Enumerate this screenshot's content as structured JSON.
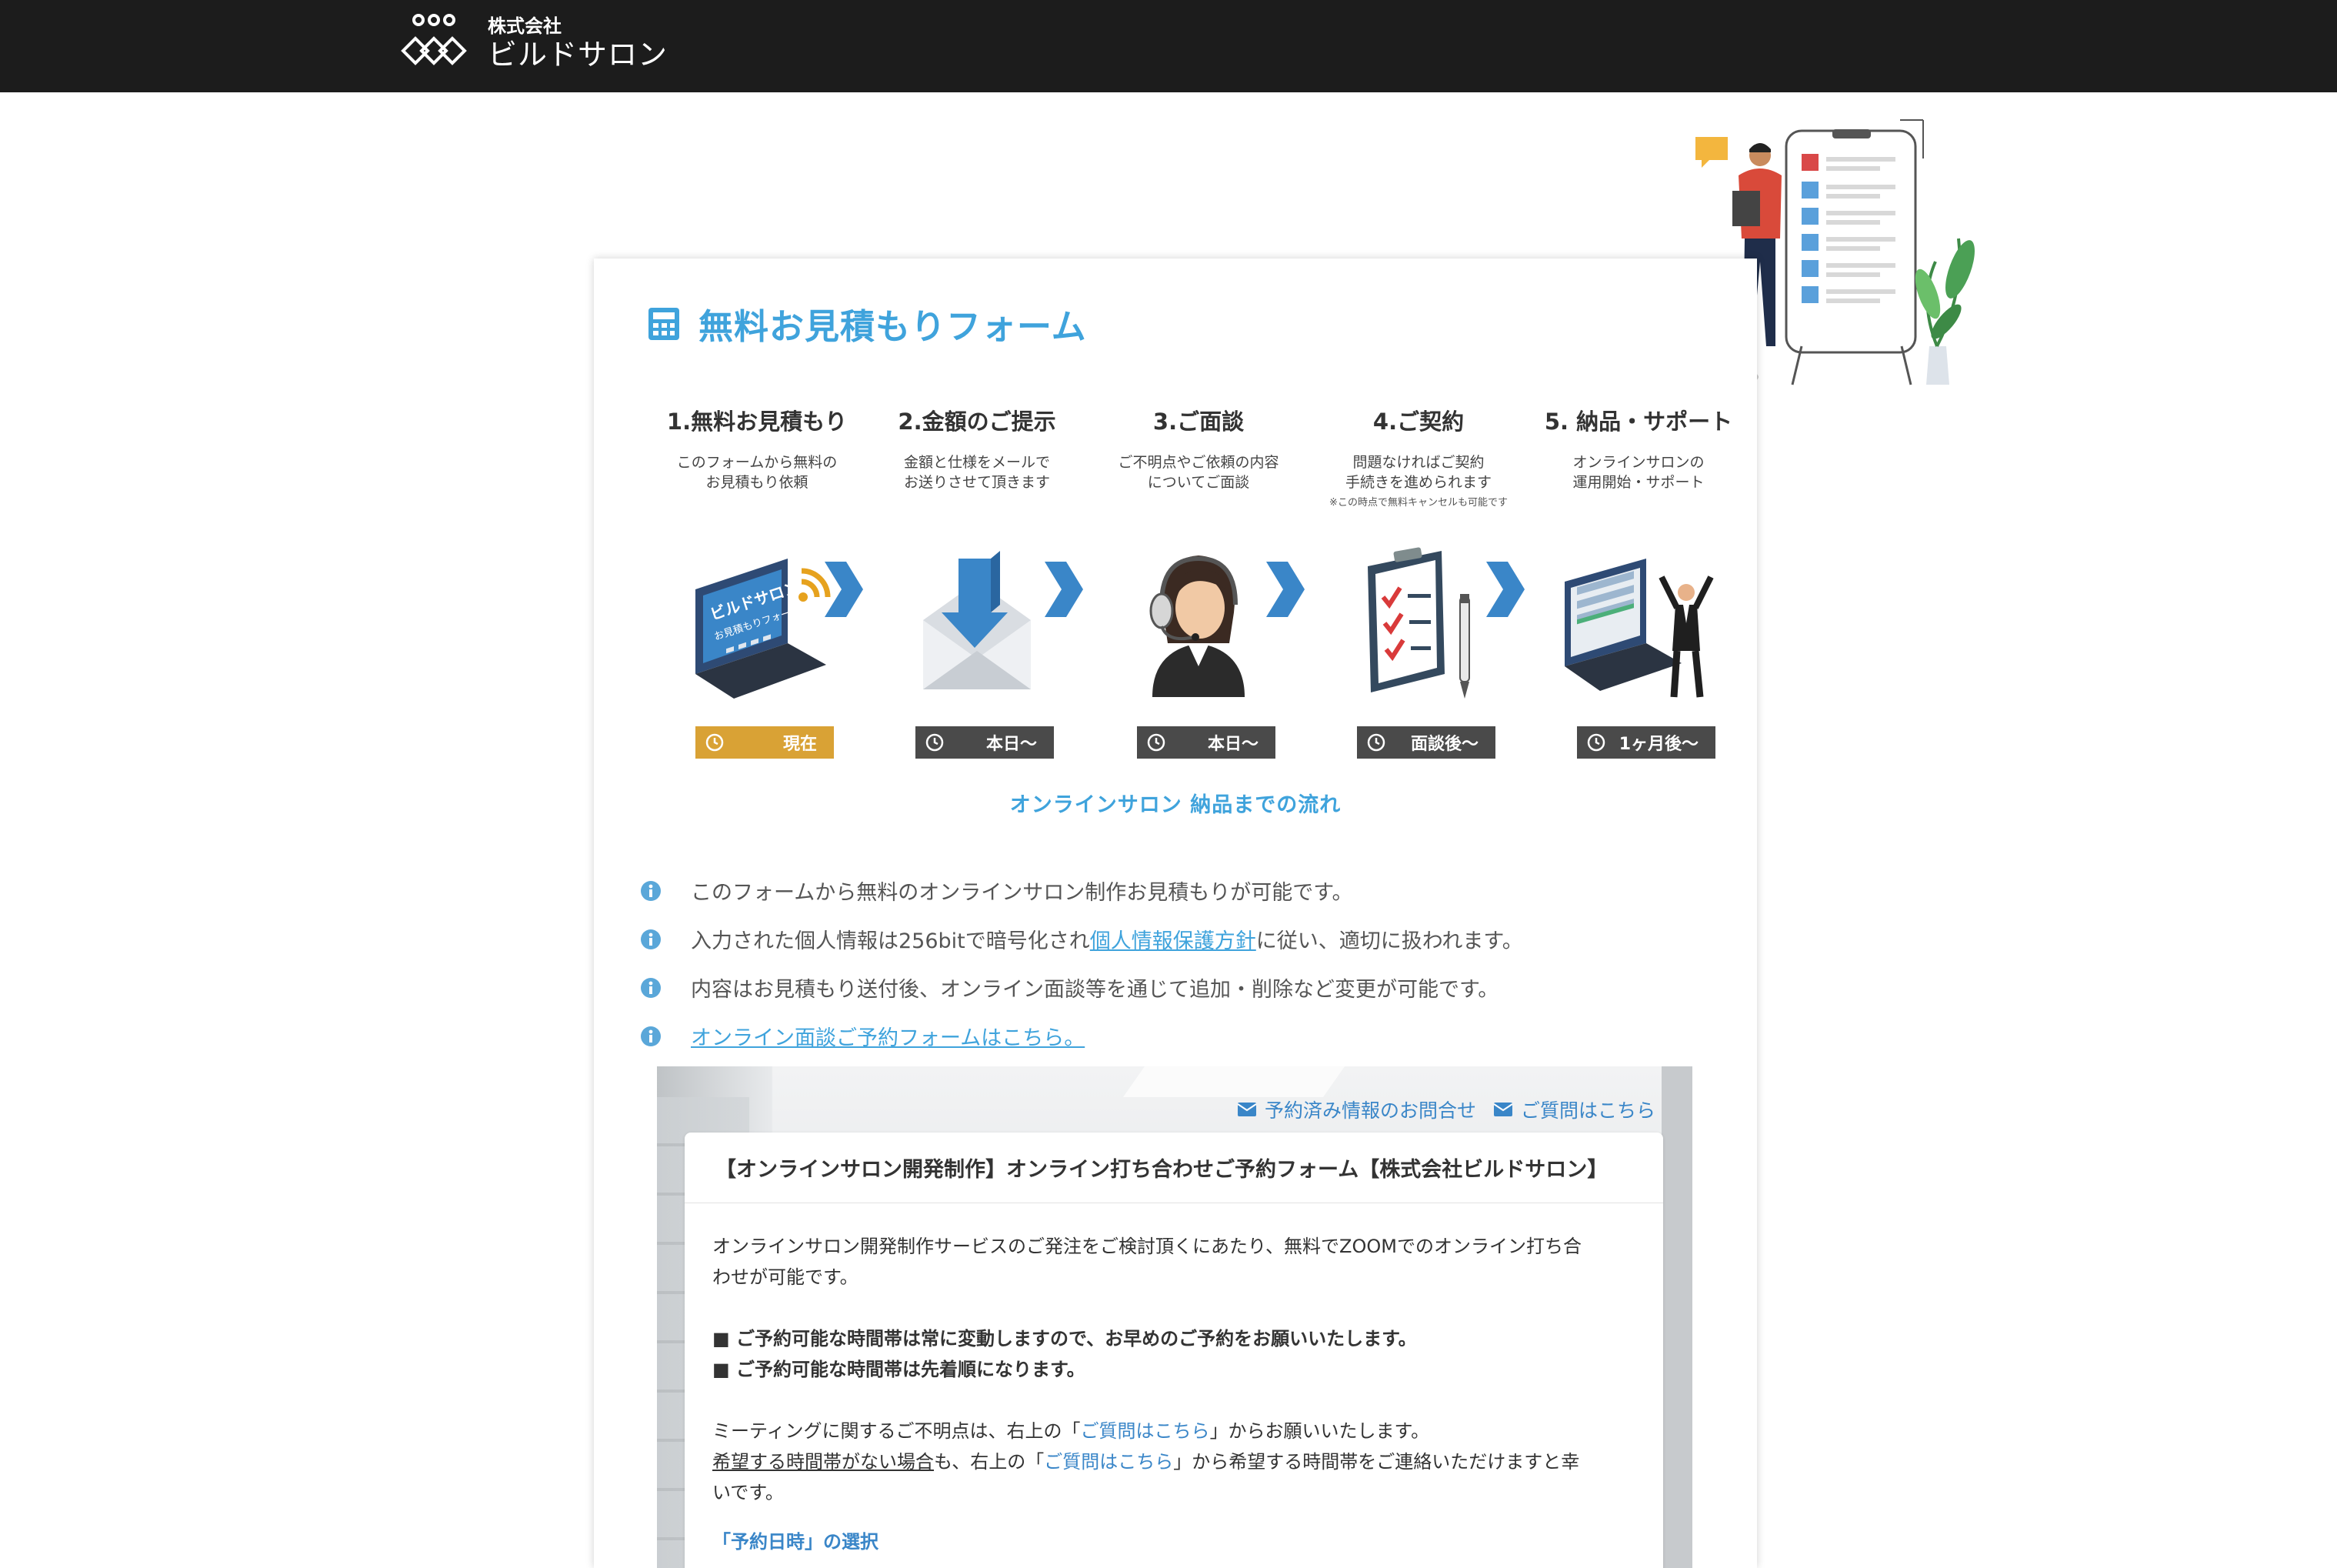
{
  "header": {
    "logo_corp": "株式会社",
    "logo_name": "ビルドサロン"
  },
  "form": {
    "title": "無料お見積もりフォーム",
    "title_icon": "calculator-icon"
  },
  "steps": [
    {
      "title": "1.無料お見積もり",
      "desc1": "このフォームから無料の",
      "desc2": "お見積もり依頼",
      "note": "",
      "badge": "現在",
      "current": true,
      "icon": "laptop-icon",
      "laptop_text1": "ビルドサロン",
      "laptop_text2": "お見積もりフォーム"
    },
    {
      "title": "2.金額のご提示",
      "desc1": "金額と仕様をメールで",
      "desc2": "お送りさせて頂きます",
      "note": "",
      "badge": "本日〜",
      "current": false,
      "icon": "mail-download-icon"
    },
    {
      "title": "3.ご面談",
      "desc1": "ご不明点やご依頼の内容",
      "desc2": "についてご面談",
      "note": "",
      "badge": "本日〜",
      "current": false,
      "icon": "operator-headset-icon"
    },
    {
      "title": "4.ご契約",
      "desc1": "問題なければご契約",
      "desc2": "手続きを進められます",
      "note": "※この時点で無料キャンセルも可能です",
      "badge": "面談後〜",
      "current": false,
      "icon": "checklist-clipboard-icon"
    },
    {
      "title": "5. 納品・サポート",
      "desc1": "オンラインサロンの",
      "desc2": "運用開始・サポート",
      "note": "",
      "badge": "1ヶ月後〜",
      "current": false,
      "icon": "laptop-celebrate-icon"
    }
  ],
  "flow_caption": "オンラインサロン 納品までの流れ",
  "notes": [
    {
      "text": "このフォームから無料のオンラインサロン制作お見積もりが可能です。"
    },
    {
      "before": "入力された個人情報は256bitで暗号化され",
      "link": "個人情報保護方針",
      "after": "に従い、適切に扱われます。"
    },
    {
      "text": "内容はお見積もり送付後、オンライン面談等を通じて追加・削除など変更が可能です。"
    },
    {
      "link": "オンライン面談ご予約フォームはこちら。"
    }
  ],
  "booking": {
    "link_inquiry": "予約済み情報のお問合せ",
    "link_question": "ご質問はこちら",
    "title": "【オンラインサロン開発制作】オンライン打ち合わせご予約フォーム【株式会社ビルドサロン】",
    "p1_line1": "オンラインサロン開発制作サービスのご発注をご検討頂くにあたり、無料でZOOMでのオンライン打ち合",
    "p1_line2": "わせが可能です。",
    "b1": "■ ご予約可能な時間帯は常に変動しますので、お早めのご予約をお願いいたします。",
    "b2": "■ ご予約可能な時間帯は先着順になります。",
    "p2_before": "ミーティングに関するご不明点は、右上の「",
    "p2_link": "ご質問はこちら",
    "p2_after": "」からお願いいたします。",
    "p3_underline": "希望する時間帯がない場合",
    "p3_mid": "も、右上の「",
    "p3_link": "ご質問はこちら",
    "p3_after": "」から希望する時間帯をご連絡いただけますと幸",
    "p3_line2": "いです。",
    "section": "「予約日時」の選択"
  },
  "colors": {
    "accent": "#3fa3dc",
    "current_badge": "#d9a235",
    "badge": "#4a4a4a",
    "header_bg": "#1c1c1c"
  }
}
